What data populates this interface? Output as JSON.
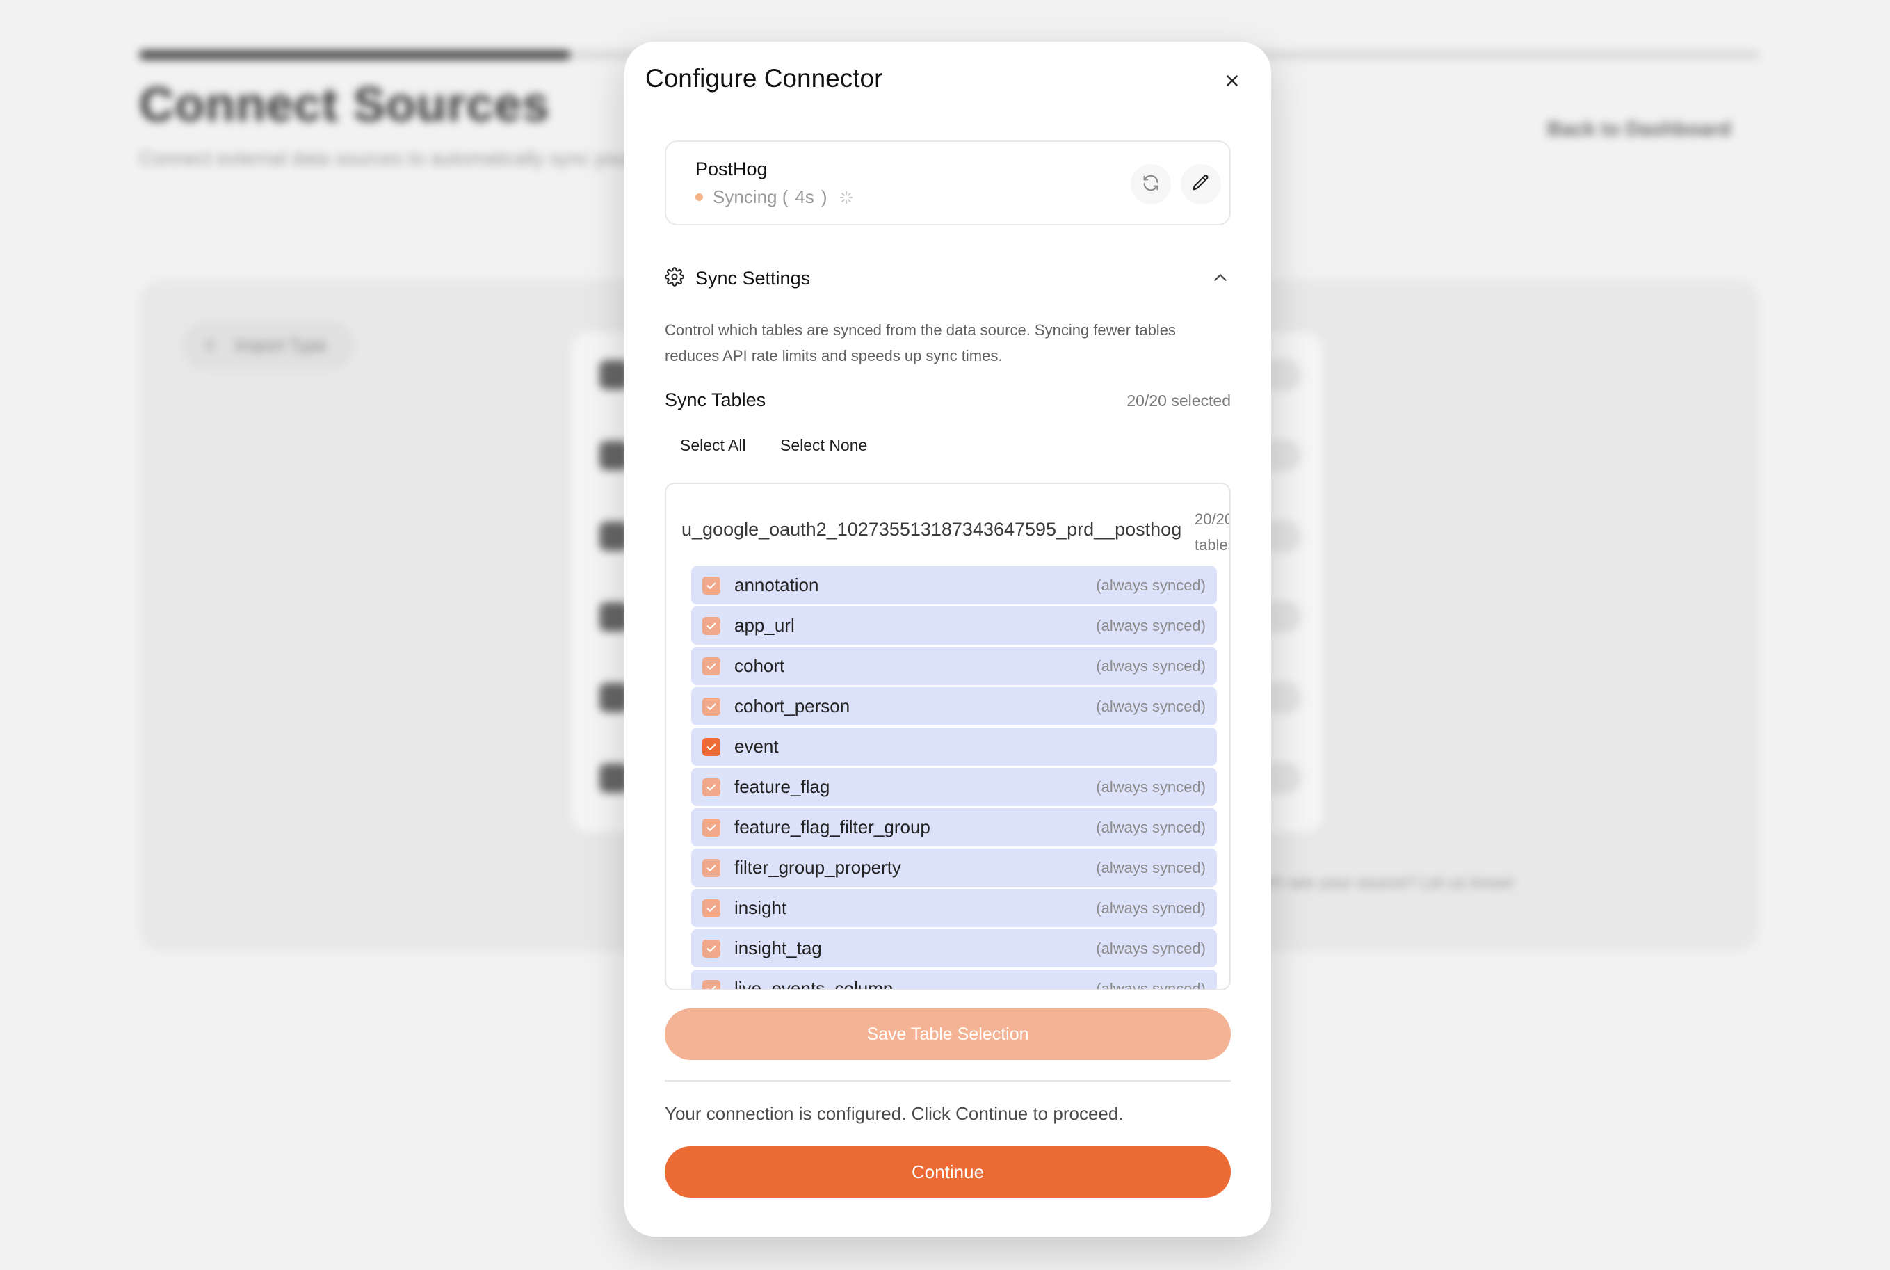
{
  "background": {
    "title": "Connect Sources",
    "subtitle": "Connect external data sources to automatically sync your data",
    "back_link": "Back to Dashboard",
    "import_type": "Import Type",
    "note": "Don't see your source? Let us know!"
  },
  "modal": {
    "title": "Configure Connector",
    "connector": {
      "name": "PostHog",
      "status_label": "Syncing (",
      "status_elapsed": "4s",
      "status_close": ")",
      "status_color": "#f3b48a"
    },
    "sync_settings": {
      "title": "Sync Settings",
      "description": "Control which tables are synced from the data source. Syncing fewer tables reduces API rate limits and speeds up sync times.",
      "tables_label": "Sync Tables",
      "selected_count": "20/20 selected",
      "select_all": "Select All",
      "select_none": "Select None",
      "schema_name": "u_google_oauth2_102735513187343647595_prd__posthog",
      "schema_count_line1": "20/20",
      "schema_count_line2": "tables",
      "rows": [
        {
          "name": "annotation",
          "tag": "(always synced)"
        },
        {
          "name": "app_url",
          "tag": "(always synced)"
        },
        {
          "name": "cohort",
          "tag": "(always synced)"
        },
        {
          "name": "cohort_person",
          "tag": "(always synced)"
        },
        {
          "name": "event",
          "tag": ""
        },
        {
          "name": "feature_flag",
          "tag": "(always synced)"
        },
        {
          "name": "feature_flag_filter_group",
          "tag": "(always synced)"
        },
        {
          "name": "filter_group_property",
          "tag": "(always synced)"
        },
        {
          "name": "insight",
          "tag": "(always synced)"
        },
        {
          "name": "insight_tag",
          "tag": "(always synced)"
        },
        {
          "name": "live_events_column",
          "tag": "(always synced)"
        }
      ]
    },
    "save_label": "Save Table Selection",
    "configured_text": "Your connection is configured. Click Continue to proceed.",
    "continue_label": "Continue",
    "colors": {
      "accent": "#ec6a33",
      "accent_light": "#f3b394",
      "row_bg": "#dde2fb"
    }
  }
}
